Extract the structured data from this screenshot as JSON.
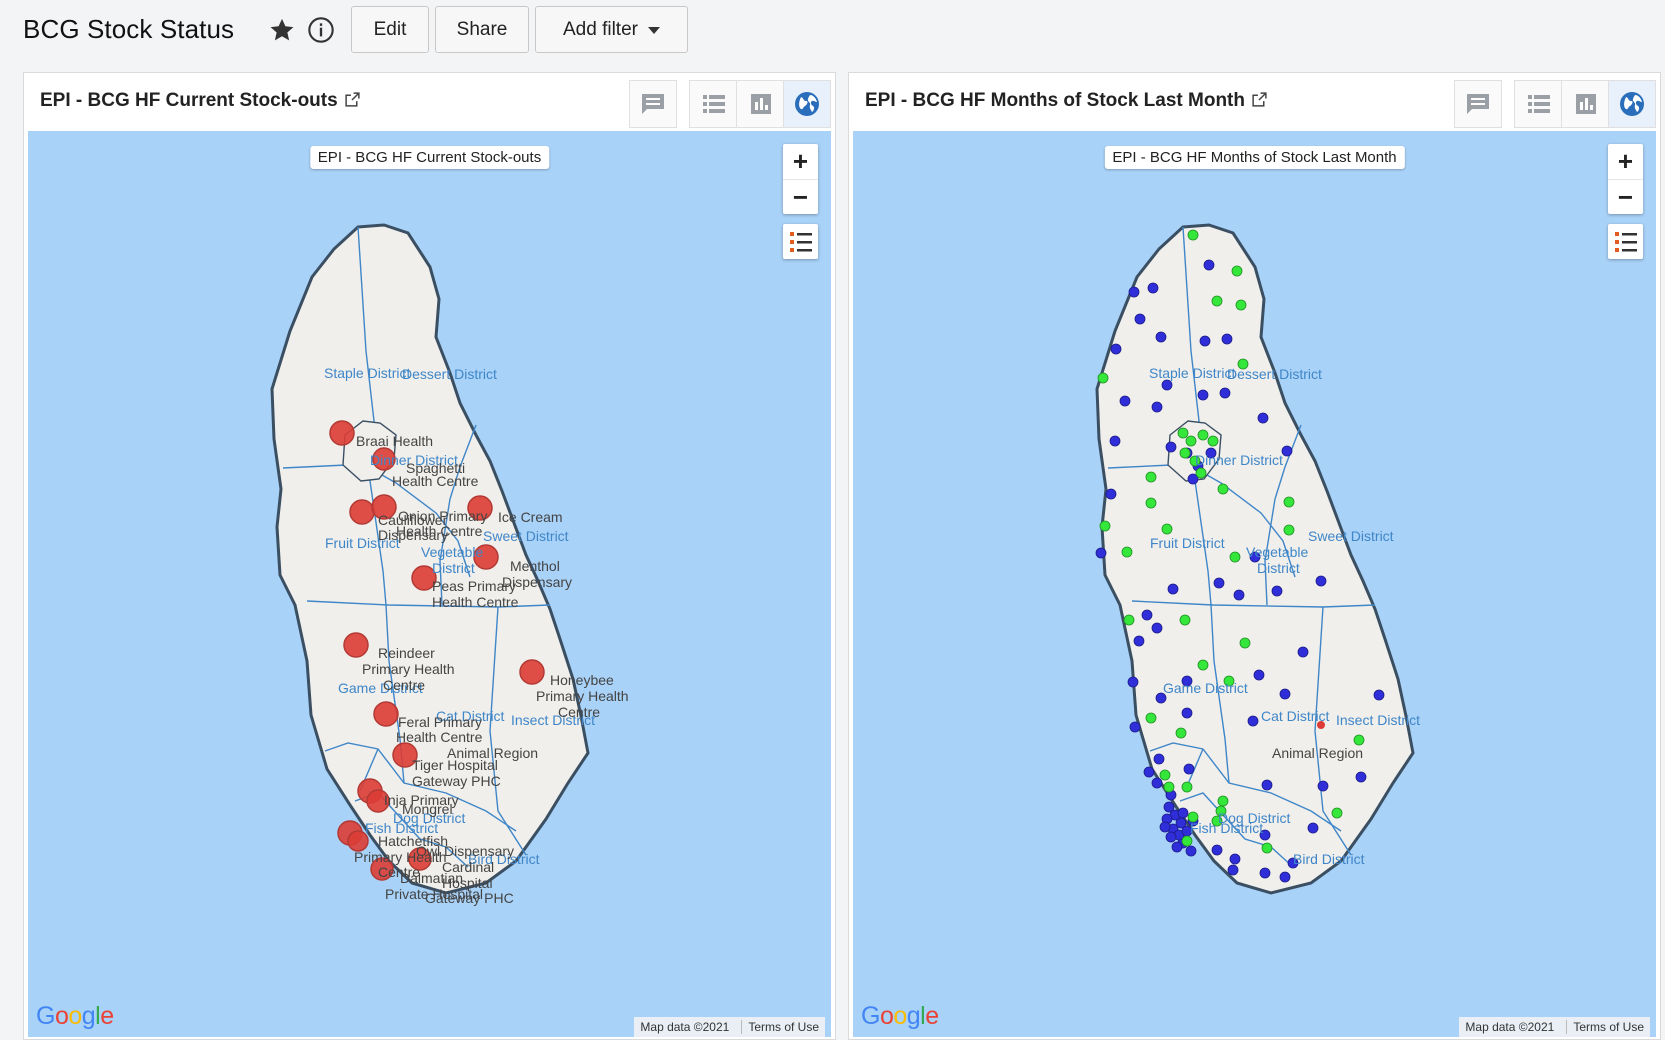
{
  "dashboard": {
    "title": "BCG Stock Status",
    "buttons": {
      "edit": "Edit",
      "share": "Share",
      "add_filter": "Add filter"
    }
  },
  "panels": [
    {
      "title": "EPI - BCG HF Current Stock-outs",
      "map_label": "EPI - BCG HF Current Stock-outs",
      "google": "Google",
      "map_data": "Map data ©2021",
      "terms": "Terms of Use",
      "districts": [
        "Staple District",
        "Dessert District",
        "Dinner District",
        "Fruit District",
        "Sweet District",
        "Vegetable District",
        "Game District",
        "Cat District",
        "Insect District",
        "Fish District",
        "Dog District",
        "Bird District",
        "Animal Region"
      ],
      "facilities": [
        "Braai Health",
        "Spaghetti Health Centre",
        "Cauliflower Dispensary",
        "Onion Primary Health Centre",
        "Ice Cream",
        "Menthol Dispensary",
        "Peas Primary Health Centre",
        "Reindeer Primary Health Centre",
        "Honeybee Primary Health Centre",
        "Feral Primary Health Centre",
        "Tiger Hospital",
        "Gateway PHC",
        "Inja Primary",
        "Mongrel",
        "Hatchetfish Primary Health Centre",
        "Owl Dispensary",
        "Cardinal",
        "Dalmatian",
        "Hospital",
        "Private Hospital",
        "Gateway PHC"
      ]
    },
    {
      "title": "EPI - BCG HF Months of Stock Last Month",
      "map_label": "EPI - BCG HF Months of Stock Last Month",
      "google": "Google",
      "map_data": "Map data ©2021",
      "terms": "Terms of Use",
      "districts": [
        "Staple District",
        "Dessert District",
        "Dinner District",
        "Fruit District",
        "Sweet District",
        "Vegetable District",
        "Game District",
        "Cat District",
        "Insect District",
        "Fish District",
        "Dog District",
        "Bird District",
        "Animal Region"
      ]
    }
  ],
  "colors": {
    "stockout": "#dc3c35",
    "adequate": "#34e73a",
    "stock": "#2f2ed8",
    "water": "#a9d2f8",
    "land": "#f0efeb",
    "border": "#3b4f63",
    "accent": "#2a6ebb"
  },
  "icons": [
    "star-icon",
    "info-icon",
    "external-link-icon",
    "comment-icon",
    "table-icon",
    "chart-icon",
    "globe-icon",
    "legend-icon"
  ]
}
